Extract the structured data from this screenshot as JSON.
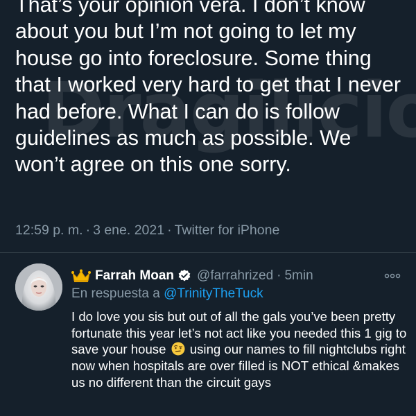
{
  "main_tweet": {
    "text": "That’s your opinion vera. I don’t know\nabout you but I’m not going to let my\nhouse go into foreclosure. Some thing\nthat I worked very hard to get that I never\nhad before. What I can do is follow\nguidelines as much as possible. We\nwon’t agree on this one sorry.",
    "time": "12:59 p. m.",
    "date": "3 ene. 2021",
    "source": "Twitter for iPhone",
    "separator": "·"
  },
  "watermark": "Dragilicious",
  "reply": {
    "author_name": "Farrah Moan",
    "handle": "@farrahrized",
    "time_ago": "5min",
    "dot": "·",
    "reply_prefix": "En respuesta a ",
    "reply_mention": "@TrinityTheTuck",
    "text_before_emoji": "I do love you sis but out of all the gals you’ve been pretty fortunate this year let’s not act like you needed this 1 gig to save your house",
    "text_after_emoji": "using our names to fill nightclubs right now when hospitals are over filled is NOT ethical &makes us no different than the circuit gays"
  },
  "icons": {
    "crown": "crown-icon",
    "verified": "verified-badge-icon",
    "more": "more-options-icon",
    "emoji": "face-with-raised-eyebrow-emoji"
  },
  "colors": {
    "background": "#15202b",
    "text": "#ffffff",
    "secondary": "#8899a6",
    "link": "#1da1f2",
    "divider": "#38444d"
  }
}
